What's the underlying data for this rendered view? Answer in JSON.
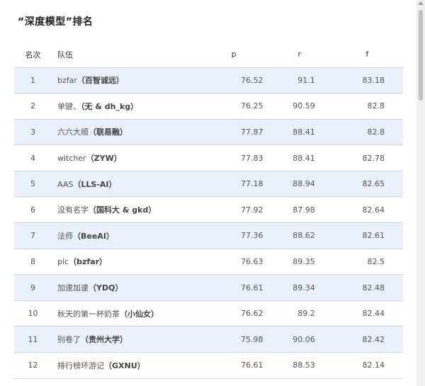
{
  "title": "“深度模型”排名",
  "columns": {
    "rank": "名次",
    "team": "队伍",
    "p": "p",
    "r": "r",
    "f": "f"
  },
  "rows": [
    {
      "rank": "1",
      "name": "bzfar",
      "org": "（百智诚远）",
      "p": "76.52",
      "r": "91.1",
      "f": "83.18"
    },
    {
      "rank": "2",
      "name": "单键、",
      "org": "（无 & dh_kg）",
      "p": "76.25",
      "r": "90.59",
      "f": "82.8"
    },
    {
      "rank": "3",
      "name": "六六大顺",
      "org": "（联易融）",
      "p": "77.87",
      "r": "88.41",
      "f": "82.8"
    },
    {
      "rank": "4",
      "name": "witcher",
      "org": "（ZYW）",
      "p": "77.83",
      "r": "88.41",
      "f": "82.78"
    },
    {
      "rank": "5",
      "name": "AAS",
      "org": "（LLS-AI）",
      "p": "77.18",
      "r": "88.94",
      "f": "82.65"
    },
    {
      "rank": "6",
      "name": "没有名字",
      "org": "（国科大 & gkd）",
      "p": "77.92",
      "r": "87.98",
      "f": "82.64"
    },
    {
      "rank": "7",
      "name": "法师",
      "org": "（BeeAI）",
      "p": "77.36",
      "r": "88.62",
      "f": "82.61"
    },
    {
      "rank": "8",
      "name": "pic",
      "org": "（bzfar）",
      "p": "76.63",
      "r": "89.35",
      "f": "82.5"
    },
    {
      "rank": "9",
      "name": "加速加速",
      "org": "（YDQ）",
      "p": "76.61",
      "r": "89.34",
      "f": "82.48"
    },
    {
      "rank": "10",
      "name": "秋天的第一杯奶茶",
      "org": "（小仙女）",
      "p": "76.62",
      "r": "89.2",
      "f": "82.44"
    },
    {
      "rank": "11",
      "name": "别卷了",
      "org": "（贵州大学）",
      "p": "75.98",
      "r": "90.06",
      "f": "82.42"
    },
    {
      "rank": "12",
      "name": "排行榜坏游记",
      "org": "（GXNU）",
      "p": "76.61",
      "r": "88.53",
      "f": "82.14"
    }
  ]
}
